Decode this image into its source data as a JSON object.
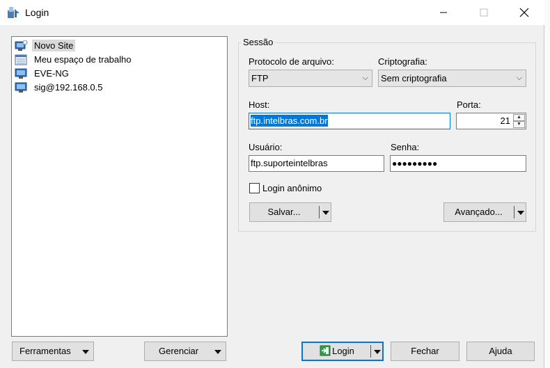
{
  "window": {
    "title": "Login"
  },
  "sites": [
    {
      "label": "Novo Site",
      "icon": "new-site-icon",
      "selected": true
    },
    {
      "label": "Meu espaço de trabalho",
      "icon": "workspace-icon",
      "selected": false
    },
    {
      "label": "EVE-NG",
      "icon": "monitor-icon",
      "selected": false
    },
    {
      "label": "sig@192.168.0.5",
      "icon": "monitor-icon",
      "selected": false
    }
  ],
  "session": {
    "group_title": "Sessão",
    "protocol_label": "Protocolo de arquivo:",
    "protocol_value": "FTP",
    "encryption_label": "Criptografia:",
    "encryption_value": "Sem criptografia",
    "host_label": "Host:",
    "host_value": "ftp.intelbras.com.br",
    "port_label": "Porta:",
    "port_value": "21",
    "user_label": "Usuário:",
    "user_value": "ftp.suporteintelbras",
    "password_label": "Senha:",
    "password_mask": "●●●●●●●●●",
    "anonymous_label": "Login anônimo",
    "save_button": "Salvar...",
    "advanced_button": "Avançado..."
  },
  "footer": {
    "tools_button": "Ferramentas",
    "manage_button": "Gerenciar",
    "login_button": "Login",
    "close_button": "Fechar",
    "help_button": "Ajuda"
  },
  "colors": {
    "accent": "#0078d7",
    "login_icon": "#2ea043"
  }
}
